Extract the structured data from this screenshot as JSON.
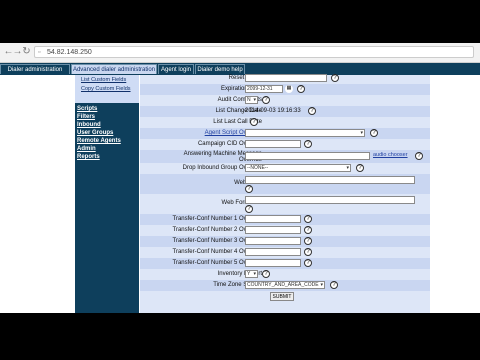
{
  "browser": {
    "url": "54.82.148.250"
  },
  "tabs": [
    {
      "label": "Dialer administration"
    },
    {
      "label": "Advanced dialer administration"
    },
    {
      "label": "Agent login"
    },
    {
      "label": "Dialer demo help"
    }
  ],
  "leftnav": {
    "sublinks": [
      "List Custom Fields",
      "Copy Custom Fields"
    ],
    "links": [
      "Scripts",
      "Filters",
      "Inbound",
      "User Groups",
      "Remote Agents",
      "Admin",
      "Reports"
    ]
  },
  "form": {
    "row0": {
      "label": "Reset Times"
    },
    "expiration": {
      "label": "Expiration Date",
      "value": "2099-12-31"
    },
    "audit": {
      "label": "Audit Comments",
      "value": "N"
    },
    "change_date": {
      "label": "List Change Date",
      "value": "2014-09-03 19:16:33"
    },
    "last_call": {
      "label": "List Last Call Date",
      "value": ""
    },
    "agent_script": {
      "label": "Agent Script Override",
      "value": ""
    },
    "campaign_cid": {
      "label": "Campaign CID Override",
      "value": ""
    },
    "am_message": {
      "label_1": "Answering Machine Message",
      "label_2": "Override",
      "link": "audio chooser"
    },
    "drop_inbound": {
      "label": "Drop Inbound Group Override",
      "value": "--NONE--"
    },
    "web_form": {
      "label": "Web Form"
    },
    "web_form_two": {
      "label": "Web Form Two"
    },
    "tc1": {
      "label": "Transfer-Conf Number 1 Override"
    },
    "tc2": {
      "label": "Transfer-Conf Number 2 Override"
    },
    "tc3": {
      "label": "Transfer-Conf Number 3 Override"
    },
    "tc4": {
      "label": "Transfer-Conf Number 4 Override"
    },
    "tc5": {
      "label": "Transfer-Conf Number 5 Override"
    },
    "inventory": {
      "label": "Inventory Report",
      "value": "Y"
    },
    "timezone": {
      "label": "Time Zone Setting",
      "value": "COUNTRY_AND_AREA_CODE"
    },
    "submit": "SUBMIT",
    "help": "?"
  }
}
